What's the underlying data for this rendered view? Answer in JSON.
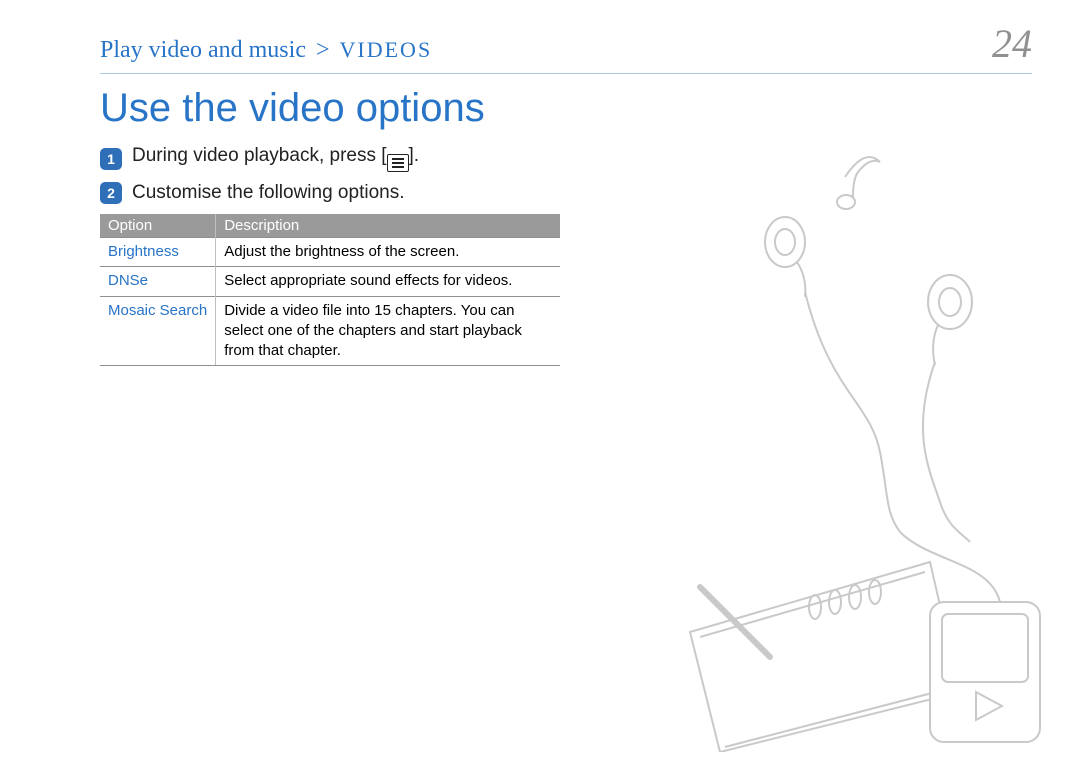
{
  "header": {
    "breadcrumb_main": "Play video and music",
    "breadcrumb_sep": ">",
    "breadcrumb_section": "VIDEOS",
    "page_number": "24"
  },
  "title": "Use the video options",
  "steps": [
    {
      "num": "1",
      "text_before": "During video playback, press [",
      "text_after": "]."
    },
    {
      "num": "2",
      "text": "Customise the following options."
    }
  ],
  "table": {
    "head_option": "Option",
    "head_description": "Description",
    "rows": [
      {
        "option": "Brightness",
        "desc": "Adjust the brightness of the screen."
      },
      {
        "option": "DNSe",
        "desc": "Select appropriate sound effects for videos."
      },
      {
        "option": "Mosaic Search",
        "desc": "Divide a video file into 15 chapters. You can select one of the chapters and start playback from that chapter."
      }
    ]
  }
}
